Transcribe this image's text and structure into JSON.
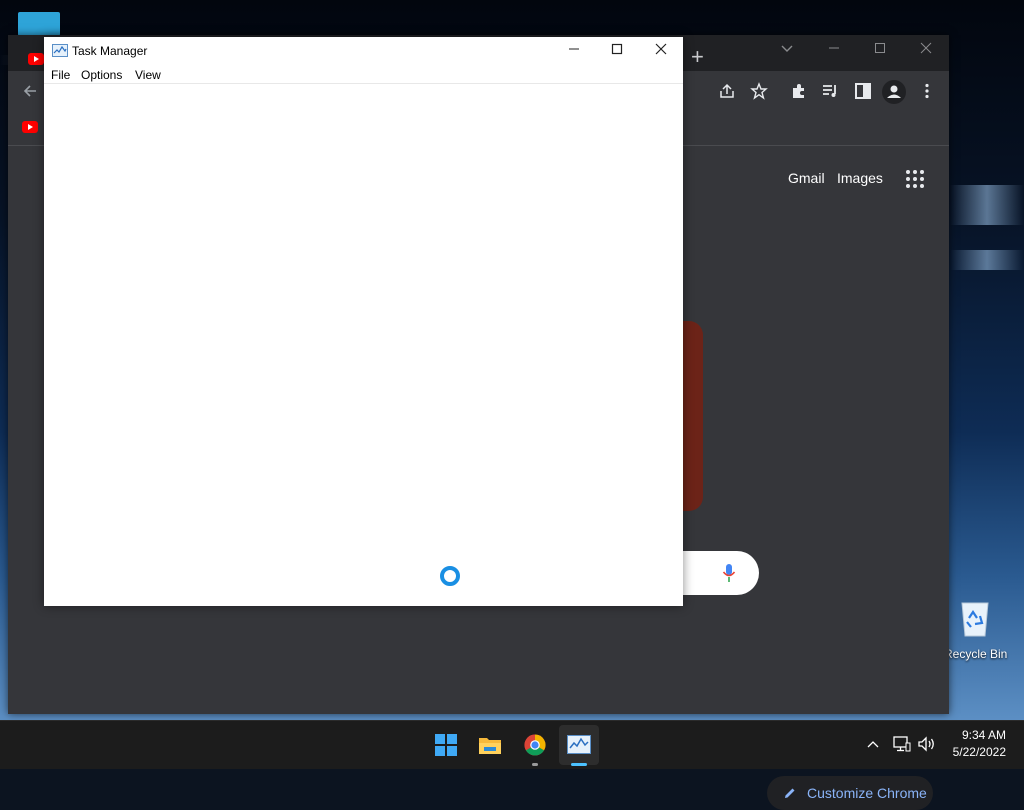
{
  "desktop": {
    "recycle_bin_label": "Recycle Bin"
  },
  "chrome": {
    "new_tab_glyph": "+",
    "header_links": [
      "Gmail",
      "Images"
    ],
    "customize_label": "Customize Chrome",
    "accent_color": "#8ab4f8",
    "background_color": "#35363a"
  },
  "task_manager": {
    "title": "Task Manager",
    "menu": [
      "File",
      "Options",
      "View"
    ],
    "state": "loading"
  },
  "taskbar": {
    "time": "9:34 AM",
    "date": "5/22/2022",
    "apps": [
      "start-icon",
      "file-explorer-icon",
      "chrome-icon",
      "task-manager-icon"
    ]
  }
}
